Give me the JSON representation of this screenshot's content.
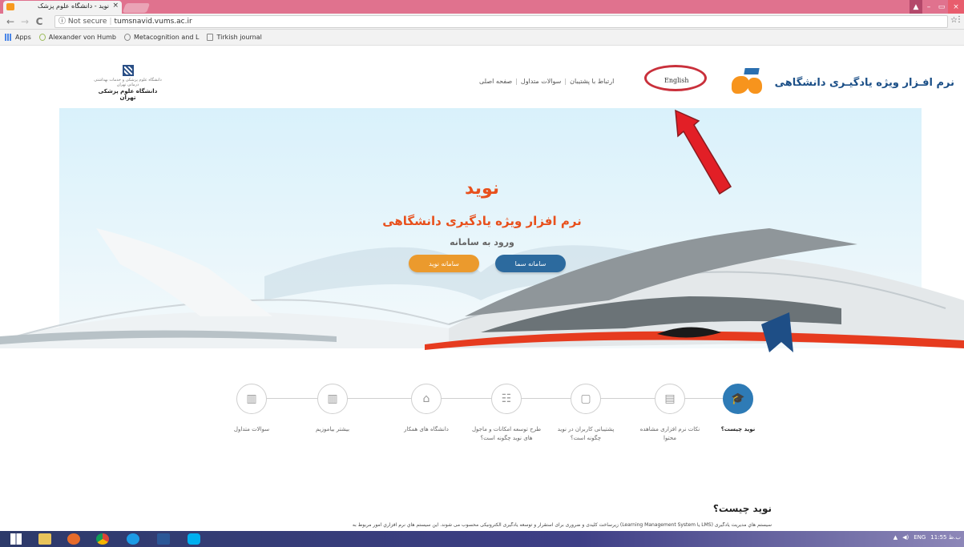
{
  "browser": {
    "tab_title": "نوید - دانشگاه علوم پزشک",
    "tab_close": "×",
    "address_security": "Not secure",
    "address_url": "tumsnavid.vums.ac.ir",
    "back": "←",
    "forward": "→",
    "reload": "C",
    "info": "ⓘ",
    "star": "☆",
    "menu": "⋮",
    "bookmarks": [
      {
        "label": "Apps"
      },
      {
        "label": "Alexander von Humb"
      },
      {
        "label": "Metacognition and L"
      },
      {
        "label": "Tirkish journal"
      }
    ],
    "window_controls": {
      "minimize": "–",
      "maximize": "▭",
      "close": "×",
      "user": "👤"
    }
  },
  "header": {
    "brand_text": "نرم افـزار ویژه یادگیـری دانشگاهی",
    "english_link": "English",
    "nav": [
      "ارتباط با پشتیبان",
      "سوالات متداول",
      "صفحه اصلی"
    ],
    "university_subtitle": "دانشگاه علوم پزشکی و خدمات بهداشتی درمانی تهران",
    "university_name": "دانشگاه علوم پزشکی تهران"
  },
  "hero": {
    "title": "نوید",
    "subtitle": "نرم افزار ویژه یادگیری دانشگاهی",
    "login_label": "ورود به سامانه",
    "btn_sama": "سامانه سما",
    "btn_navid": "سامانه نوید"
  },
  "steps": [
    {
      "label": "نوید چیست؟",
      "icon": "graduation-cap-icon",
      "glyph": "🎓",
      "active": true
    },
    {
      "label": "نکات نرم افزاری مشاهده محتوا",
      "icon": "document-icon",
      "glyph": "▤",
      "active": false
    },
    {
      "label": "پشتیبانی کاربران در نوید چگونه است؟",
      "icon": "devices-icon",
      "glyph": "▢",
      "active": false
    },
    {
      "label": "طرح توسعه امکانات و ماجول های نوید چگونه است؟",
      "icon": "form-icon",
      "glyph": "☷",
      "active": false
    },
    {
      "label": "دانشگاه های همکار",
      "icon": "network-icon",
      "glyph": "⌂",
      "active": false
    },
    {
      "label": "بیشتر بیاموزیم",
      "icon": "book-icon",
      "glyph": "▥",
      "active": false
    },
    {
      "label": "سوالات متداول",
      "icon": "book-icon",
      "glyph": "▥",
      "active": false
    }
  ],
  "article": {
    "title": "نوید چیست؟",
    "body": "سیستم هاي مدیریت یادگیری (LMS یا Learning Management System) زیرساخت کلیدی و ضروری برای استقرار و توسعه یادگیری الکترونیکی محسوب می شوند. این سیستم هاي نرم افزاري امور مربوط به"
  },
  "taskbar": {
    "tray_lang": "ENG",
    "tray_time": "11:55 ب.ظ"
  },
  "colors": {
    "accent_orange": "#e8501c",
    "brand_blue": "#1b4f87",
    "button_blue": "#2c6a9e",
    "button_orange": "#eb9a2d",
    "annotation_red": "#c9303b"
  }
}
